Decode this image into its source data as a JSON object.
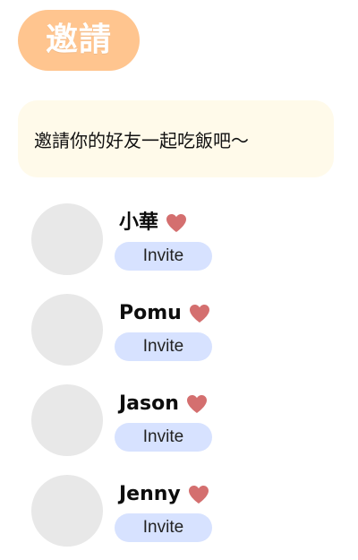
{
  "header": {
    "title": "邀請"
  },
  "message": {
    "text": "邀請你的好友一起吃飯吧～"
  },
  "friends": [
    {
      "name": "小華",
      "invite_label": "Invite",
      "icon": "heart-icon"
    },
    {
      "name": "Pomu",
      "invite_label": "Invite",
      "icon": "heart-icon"
    },
    {
      "name": "Jason",
      "invite_label": "Invite",
      "icon": "heart-icon"
    },
    {
      "name": "Jenny",
      "invite_label": "Invite",
      "icon": "heart-icon"
    }
  ],
  "colors": {
    "title_pill": "#ffc58f",
    "message_card": "#fffaea",
    "avatar": "#e8e8e8",
    "heart": "#d46f6f",
    "invite_button": "#d7e2ff"
  }
}
